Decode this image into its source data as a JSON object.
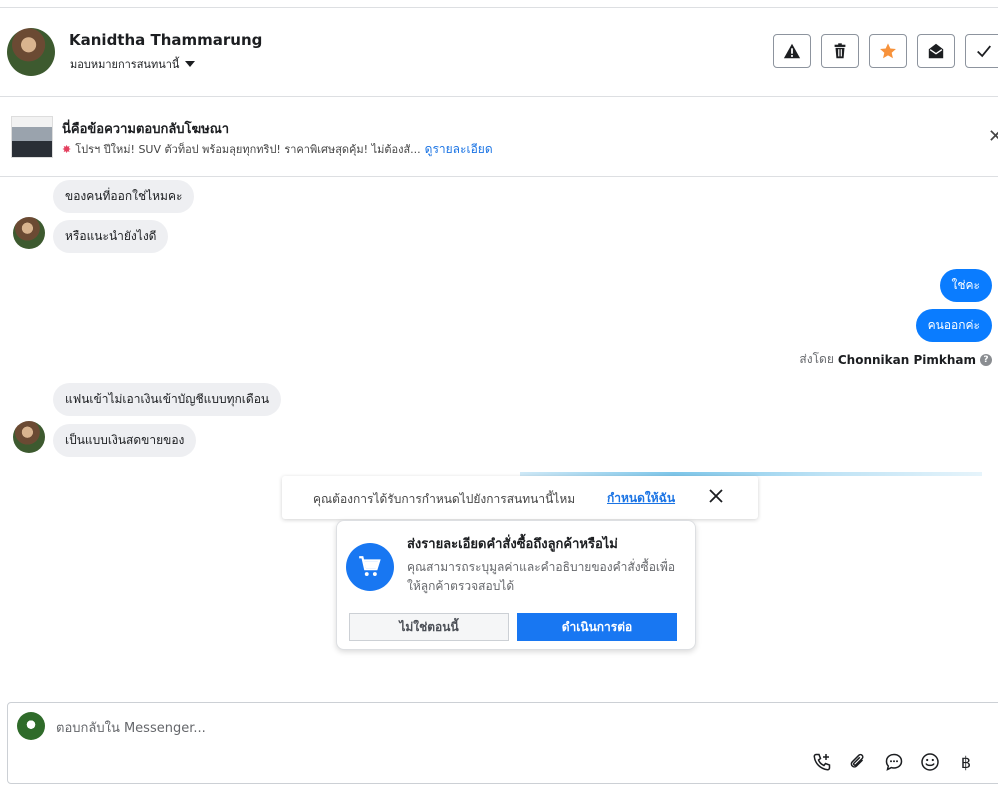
{
  "header": {
    "contact_name": "Kanidtha Thammarung",
    "assign_label": "มอบหมายการสนทนานี้",
    "actions": [
      {
        "name": "spam-icon"
      },
      {
        "name": "trash-icon"
      },
      {
        "name": "star-icon",
        "color": "#f7923b"
      },
      {
        "name": "mark-unread-icon"
      },
      {
        "name": "check-icon"
      }
    ]
  },
  "ad_banner": {
    "title": "นี่คือข้อความตอบกลับโฆษณา",
    "subtitle": "โปรฯ ปีใหม่! SUV ตัวท็อป พร้อมลุยทุกทริป! ราคาพิเศษสุดคุ้ม! ไม่ต้องสั...",
    "link": "ดูรายละเอียด"
  },
  "messages": [
    {
      "side": "in",
      "text": "ของคนที่ออกใช่ไหมคะ"
    },
    {
      "side": "in",
      "text": "หรือแนะนำยังไงดี"
    },
    {
      "side": "out",
      "text": "ใช่คะ"
    },
    {
      "side": "out",
      "text": "คนออกค่ะ"
    },
    {
      "side": "in",
      "text": "แฟนเข้าไม่เอาเงินเข้าบัญชีแบบทุกเดือน"
    },
    {
      "side": "in",
      "text": "เป็นแบบเงินสดขายของ"
    }
  ],
  "sent_by": {
    "prefix": "ส่งโดย",
    "name": "Chonnikan Pimkham",
    "help": "?"
  },
  "assign_popup": {
    "question": "คุณต้องการได้รับการกำหนดไปยังการสนทนานี้ไหม",
    "link": "กำหนดให้ฉัน"
  },
  "order_card": {
    "title": "ส่งรายละเอียดคำสั่งซื้อถึงลูกค้าหรือไม่",
    "description": "คุณสามารถระบุมูลค่าและคำอธิบายของคำสั่งซื้อเพื่อให้ลูกค้าตรวจสอบได้",
    "secondary_button": "ไม่ใช่ตอนนี้",
    "primary_button": "ดำเนินการต่อ"
  },
  "composer": {
    "placeholder": "ตอบกลับใน Messenger...",
    "tools": [
      "call-plus-icon",
      "attach-icon",
      "quick-reply-icon",
      "emoji-icon",
      "baht-icon"
    ],
    "baht_symbol": "฿"
  }
}
